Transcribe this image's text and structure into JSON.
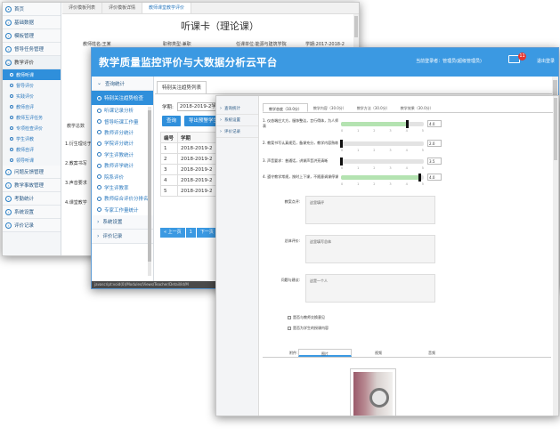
{
  "w1": {
    "sidebar": {
      "top_items": [
        "首页",
        "基础数据",
        "模板管理",
        "督导任务管理"
      ],
      "group": "教学评价",
      "subs": [
        "教师听课",
        "督导评价",
        "实践评价",
        "教师自评",
        "教师互评任务",
        "专项检查评价",
        "学生评教",
        "教师自评",
        "领导听课"
      ],
      "bottom_items": [
        "问题反馈管理",
        "教学事故管理",
        "考勤统计",
        "系统设置",
        "评价记录"
      ]
    },
    "tabs": [
      "评价模板列表",
      "评价模板详情",
      "教师课堂教学评价"
    ],
    "heading": "听课卡（理论课）",
    "info": [
      "教师姓名:王某",
      "职称类型:兼职",
      "任课单位:能源与建筑学院",
      "学期:2017-2018-2"
    ],
    "form_labels": [
      "1.衍生理论于",
      "2.教案书写",
      "3.声音要求",
      "4.课堂教学"
    ],
    "count_label": "教学总数"
  },
  "w2": {
    "title": "教学质量监控评价与大数据分析云平台",
    "login": "当前登录者：管理员(超级管理员)",
    "badge": "11",
    "logout": "退出登录",
    "sidebar": {
      "group_top": "查询统计",
      "subs": [
        "特别关注趋势检查",
        "听课记录分析",
        "督导听课工作量",
        "教师评分统计",
        "学院评分统计",
        "学生评教统计",
        "教师评学统计",
        "院系评价",
        "学生评教率",
        "教师综合评价分排名",
        "专家工作量统计"
      ],
      "group_bottom": [
        "系统设置",
        "评价记录"
      ]
    },
    "tab": "特别关注趋势列表",
    "filter_label": "学期:",
    "filter_value": "2018-2019-2学期",
    "buttons": [
      "查询",
      "导出预警学生"
    ],
    "table": {
      "headers": [
        "编号",
        "学期"
      ],
      "rows": [
        [
          "1",
          "2018-2019-2"
        ],
        [
          "2",
          "2018-2019-2"
        ],
        [
          "3",
          "2018-2019-2"
        ],
        [
          "4",
          "2018-2019-2"
        ],
        [
          "5",
          "2018-2019-2"
        ]
      ]
    },
    "pager": [
      "« 上一页",
      "1",
      "下一页"
    ],
    "status": "javascript:void(0)/Modules/Views/Teacher/Detail/Id/M"
  },
  "w3": {
    "sidebar": [
      "查询统计",
      "系统设置",
      "评价记录"
    ],
    "tabs": [
      "教学态度（10.0分）",
      "教学内容（30.0分）",
      "教学方法（30.0分）",
      "教学效果（30.0分）"
    ],
    "sliders": [
      {
        "label": "1. 仪态端庄大方，服饰整洁，言行得体，为人师表",
        "value": "4.0",
        "fraction": 0.8
      },
      {
        "label": "2. 教案书写认真规范，备课充分，教学内容熟练",
        "value": "2.0",
        "fraction": 0.0
      },
      {
        "label": "3. 声音要求：普通话，讲课声音洪亮清晰",
        "value": "3.5",
        "fraction": 0.0
      },
      {
        "label": "4. 遵守教学常规，按时上下课，不随意调课停课",
        "value": "4.0",
        "fraction": 0.95
      }
    ],
    "tick_labels": [
      "0",
      "0.5",
      "1",
      "1.5",
      "2",
      "2.5",
      "3",
      "3.5",
      "4",
      "4.5",
      "5"
    ],
    "fields": [
      {
        "label": "教案点评:",
        "text": "这里填评"
      },
      {
        "label": "总体评价:",
        "text": "这里填写总体"
      },
      {
        "label": "问题与建议:",
        "text": "这是一个人"
      }
    ],
    "checks": [
      "是否与教师交换意见",
      "是否为学生的授课内容"
    ],
    "attach_label": "附件:",
    "file_tabs": [
      "图片",
      "视频",
      "音频"
    ]
  }
}
